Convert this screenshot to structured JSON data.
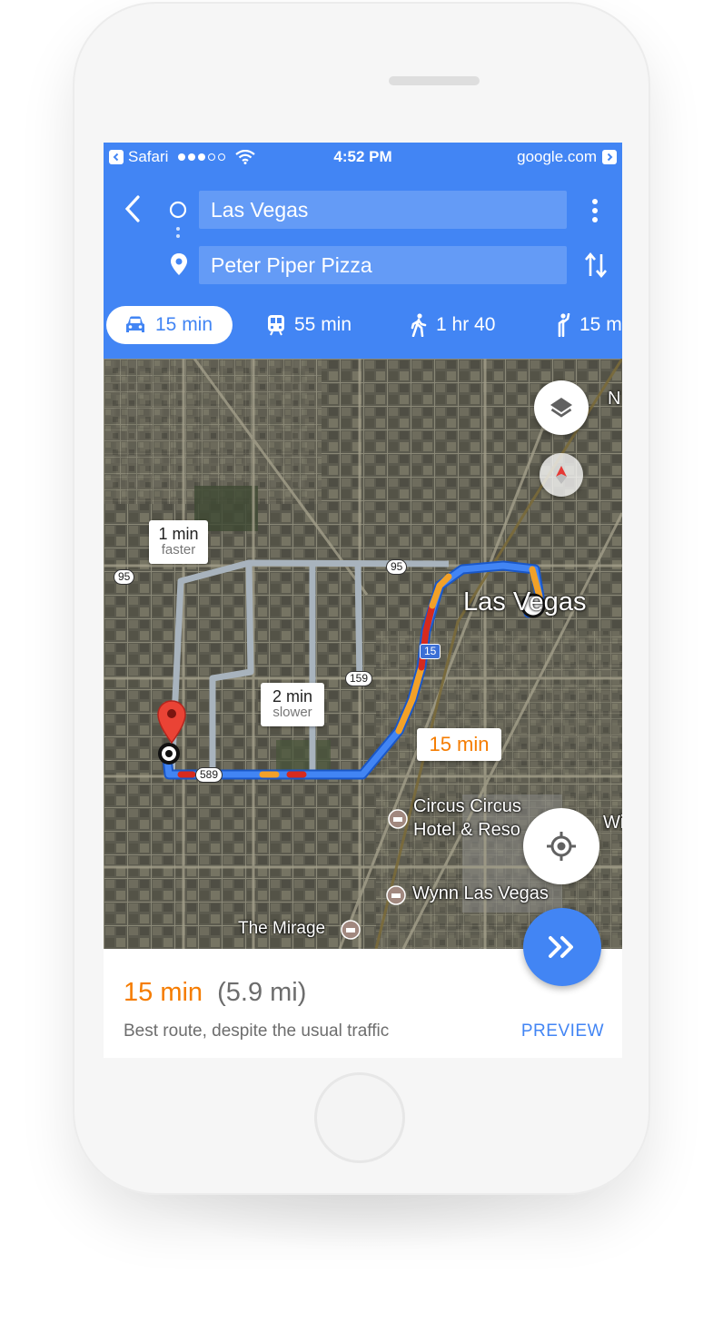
{
  "status_bar": {
    "app": "Safari",
    "time": "4:52 PM",
    "site": "google.com"
  },
  "route_header": {
    "origin": "Las Vegas",
    "destination": "Peter Piper Pizza"
  },
  "travel_modes": [
    {
      "mode": "drive",
      "icon": "car-icon",
      "label": "15 min",
      "selected": true
    },
    {
      "mode": "transit",
      "icon": "train-icon",
      "label": "55 min",
      "selected": false
    },
    {
      "mode": "walk",
      "icon": "walk-icon",
      "label": "1 hr 40",
      "selected": false
    },
    {
      "mode": "ride",
      "icon": "hail-icon",
      "label": "15 m",
      "selected": false
    }
  ],
  "map": {
    "alt_routes": [
      {
        "time": "1 min",
        "note": "faster"
      },
      {
        "time": "2 min",
        "note": "slower"
      }
    ],
    "main_route_time": "15 min",
    "city_label": "Las Vegas",
    "places": [
      "Circus Circus",
      "Hotel & Reso",
      "Wynn Las Vegas",
      "The Mirage"
    ],
    "edge_labels": [
      "N",
      "Wi"
    ],
    "road_shields": [
      "95",
      "95",
      "159",
      "589",
      "15"
    ],
    "colors": {
      "route": "#4285f4",
      "traffic_slow": "#f2a128",
      "traffic_heavy": "#d62a1e",
      "alt_route": "#a8b3bd",
      "eta": "#f57c00"
    }
  },
  "summary": {
    "duration": "15 min",
    "distance": "(5.9 mi)",
    "description": "Best route, despite the usual traffic",
    "action": "PREVIEW"
  }
}
